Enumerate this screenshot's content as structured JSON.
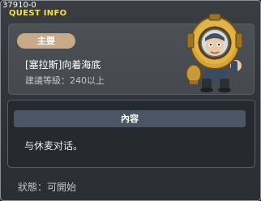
{
  "header": {
    "quest_id": "37910-0",
    "title": "QUEST INFO"
  },
  "quest": {
    "category": "主要",
    "name": "[塞拉斯]向着海底",
    "level_requirement": "建議等級：240以上",
    "npc_icon": "diving-helmet-npc-icon"
  },
  "content": {
    "header": "內容",
    "text": "与休麦对话。"
  },
  "status": {
    "text": "狀態：可開始"
  },
  "colors": {
    "title": "#f5e04a",
    "badge": "#c8a98a",
    "content_header": "#4a5663"
  }
}
